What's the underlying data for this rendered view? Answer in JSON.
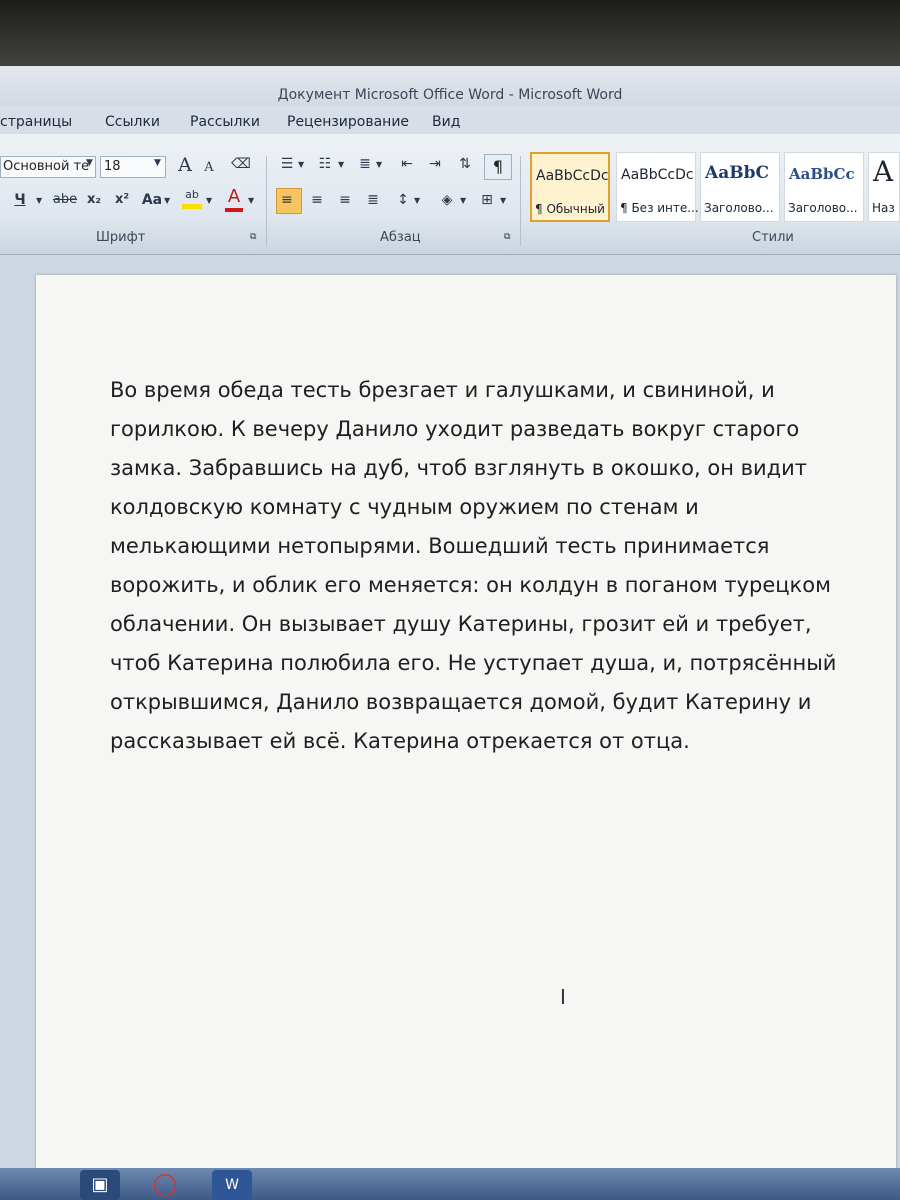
{
  "window": {
    "title": "Документ Microsoft Office Word - Microsoft Word"
  },
  "tabs": [
    "страницы",
    "Ссылки",
    "Рассылки",
    "Рецензирование",
    "Вид"
  ],
  "font_group": {
    "font_name": "Основной те",
    "font_size": "18",
    "label": "Шрифт",
    "buttons": {
      "underline": "Ч",
      "strike": "abe",
      "subscript": "x₂",
      "superscript": "x²",
      "change_case": "Aa",
      "highlight": "ab",
      "font_color": "A",
      "grow": "A",
      "shrink": "A"
    }
  },
  "paragraph_group": {
    "label": "Абзац",
    "show_marks": "¶"
  },
  "styles_group": {
    "label": "Стили",
    "tiles": [
      {
        "sample": "AaBbCcDc",
        "name": "¶ Обычный"
      },
      {
        "sample": "AaBbCcDc",
        "name": "¶ Без инте..."
      },
      {
        "sample": "AaBbC",
        "name": "Заголово..."
      },
      {
        "sample": "AaBbCc",
        "name": "Заголово..."
      },
      {
        "sample": "A",
        "name": "Наз"
      }
    ]
  },
  "document": {
    "text": "Во время обеда тесть брезгает и галушками, и свининой, и горилкою. К вечеру Данило уходит разведать вокруг старого замка. Забравшись на дуб, чтоб взглянуть в окошко, он видит колдовскую комнату с чудным оружием по стенам и мелькающими нетопырями. Вошедший тесть принимается ворожить, и облик его меняется: он колдун в поганом турецком облачении. Он вызывает душу Катерины, грозит ей и требует, чтоб Катерина полюбила его. Не уступает душа, и, потрясённый открывшимся, Данило возвращается домой, будит Катерину и рассказывает ей всё. Катерина отрекается от отца."
  },
  "colors": {
    "accent": "#e0a030",
    "font_color_bar": "#d01818",
    "highlight_bar": "#f5e000"
  }
}
